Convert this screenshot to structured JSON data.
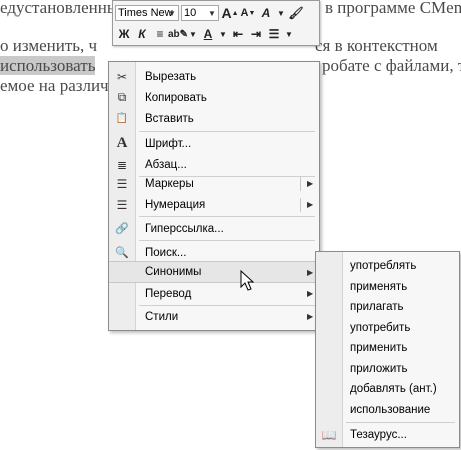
{
  "document": {
    "line1_left": "едустановленны",
    "line1_right": "в программе CMenu",
    "line2_left": "о изменить, ч",
    "line2_right": "ся в контекстном",
    "line3_selected": "использовать",
    "line3_right": "робате с файлами, так",
    "line4_left": "емое на различ"
  },
  "mini_toolbar": {
    "font_name": "Times New",
    "font_size": "10",
    "grow_font": "A",
    "shrink_font": "A",
    "styles": "A",
    "bold": "Ж",
    "italic": "К",
    "font_color": "A"
  },
  "context_menu": {
    "items": [
      {
        "label": "Вырезать",
        "icon": "scissors-icon",
        "glyph": "✂"
      },
      {
        "label": "Копировать",
        "icon": "copy-icon",
        "glyph": "⧉"
      },
      {
        "label": "Вставить",
        "icon": "paste-icon",
        "glyph": "📋"
      },
      {
        "label": "Шрифт...",
        "icon": "font-icon",
        "glyph": "A"
      },
      {
        "label": "Абзац...",
        "icon": "paragraph-icon",
        "glyph": "≣"
      },
      {
        "label": "Маркеры",
        "icon": "bullets-icon",
        "glyph": "☰"
      },
      {
        "label": "Нумерация",
        "icon": "numbering-icon",
        "glyph": "☰"
      },
      {
        "label": "Гиперссылка...",
        "icon": "hyperlink-icon",
        "glyph": "🔗"
      },
      {
        "label": "Поиск...",
        "icon": "research-icon",
        "glyph": "🔍"
      },
      {
        "label": "Синонимы",
        "icon": "",
        "glyph": ""
      },
      {
        "label": "Перевод",
        "icon": "",
        "glyph": ""
      },
      {
        "label": "Стили",
        "icon": "",
        "glyph": ""
      }
    ],
    "submenu_arrow": "▶"
  },
  "synonyms_submenu": {
    "items": [
      "употреблять",
      "применять",
      "прилагать",
      "употребить",
      "применить",
      "приложить",
      "добавлять (ант.)",
      "использование"
    ],
    "thesaurus": "Тезаурус...",
    "thesaurus_icon": "thesaurus-icon"
  }
}
